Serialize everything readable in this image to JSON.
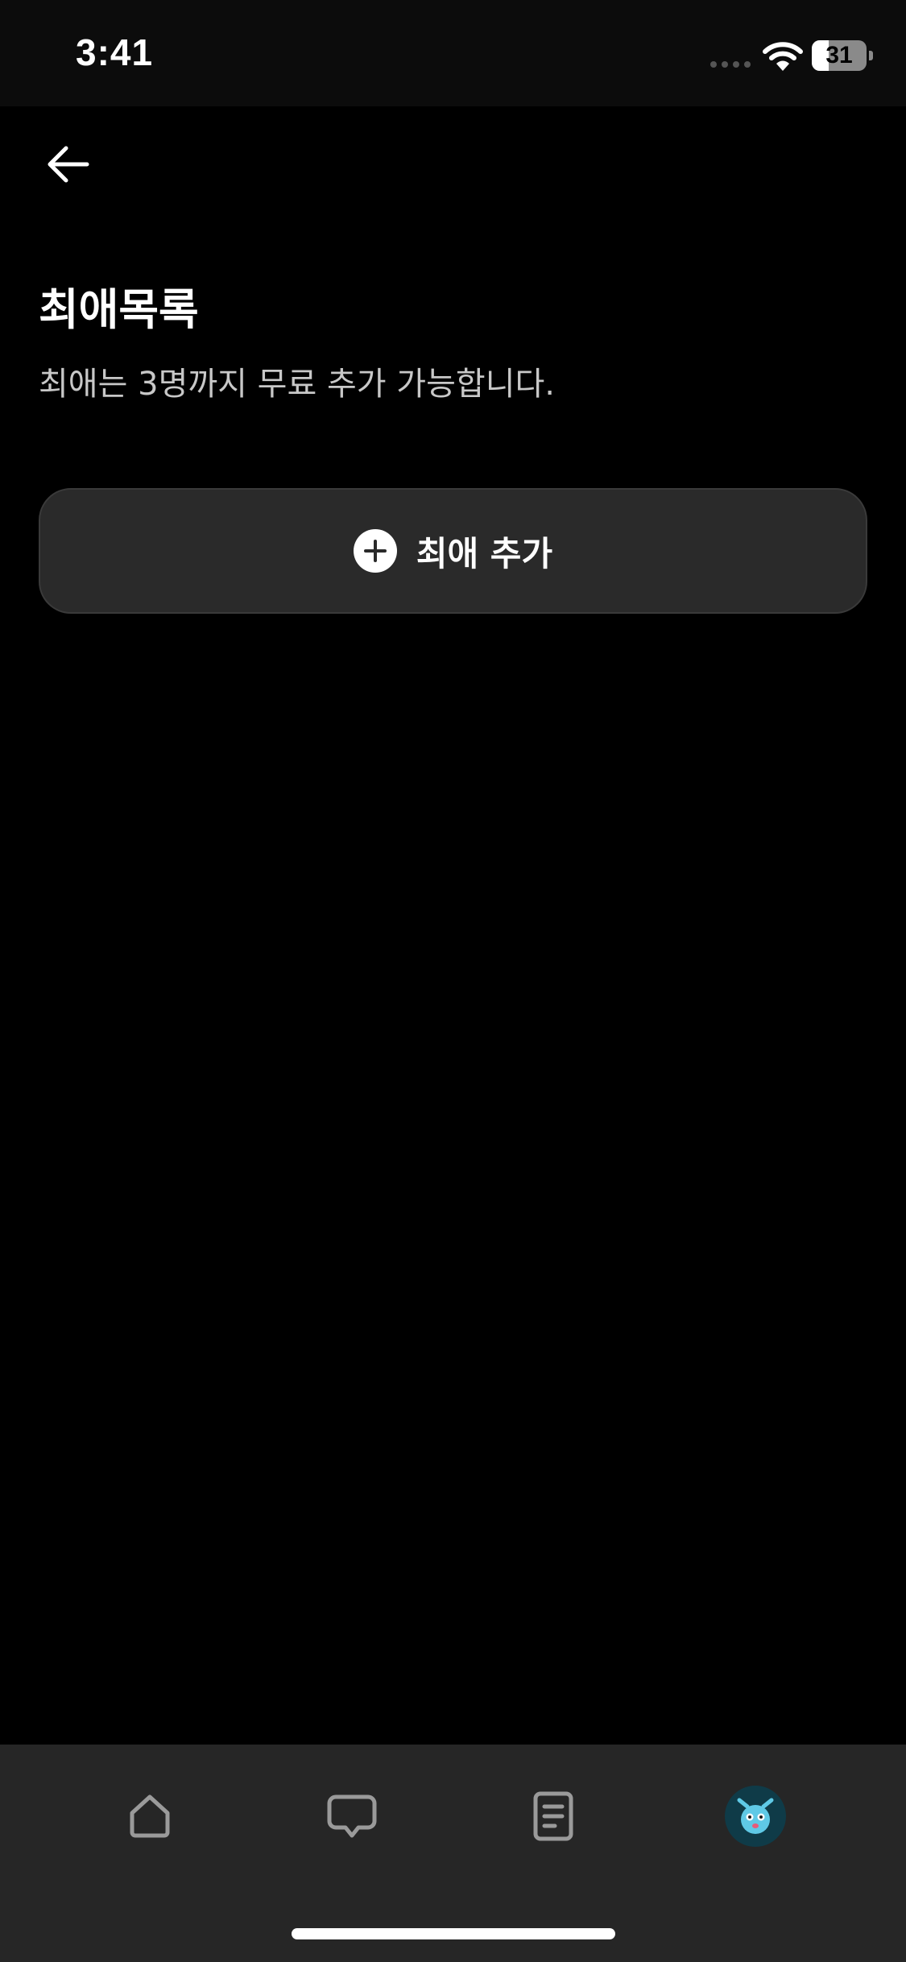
{
  "status_bar": {
    "time": "3:41",
    "battery_level": "31",
    "battery_fraction": 0.31
  },
  "header": {
    "back_icon": "arrow-left-icon"
  },
  "main": {
    "title": "최애목록",
    "subtitle": "최애는 3명까지 무료 추가 가능합니다.",
    "add_button_label": "최애 추가",
    "add_button_icon": "plus-circle-icon"
  },
  "tab_bar": {
    "items": [
      {
        "icon": "home-icon",
        "active": false
      },
      {
        "icon": "chat-bubble-icon",
        "active": false
      },
      {
        "icon": "document-icon",
        "active": false
      },
      {
        "icon": "avatar-icon",
        "active": true
      }
    ]
  },
  "colors": {
    "background": "#000000",
    "status_bar_bg": "#0c0c0c",
    "button_bg": "#2a2a2a",
    "tab_bar_bg": "#262626",
    "icon_inactive": "#9a9a9a",
    "avatar_bg": "#0f3b48",
    "avatar_face": "#5fc9e6"
  }
}
